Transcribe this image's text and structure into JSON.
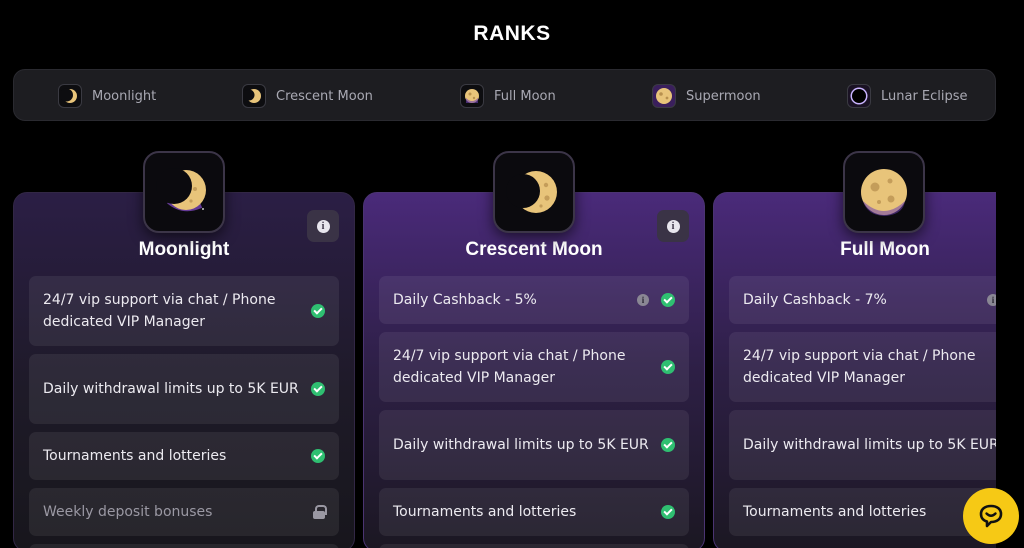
{
  "page": {
    "title": "RANKS"
  },
  "rank_tabs": [
    {
      "label": "Moonlight",
      "icon": "moonlight-icon"
    },
    {
      "label": "Crescent Moon",
      "icon": "crescent-moon-icon"
    },
    {
      "label": "Full Moon",
      "icon": "full-moon-icon"
    },
    {
      "label": "Supermoon",
      "icon": "supermoon-icon"
    },
    {
      "label": "Lunar Eclipse",
      "icon": "lunar-eclipse-icon"
    }
  ],
  "cards": [
    {
      "title": "Moonlight",
      "features": [
        {
          "text": "24/7 vip support via chat / Phone dedicated VIP Manager",
          "status": "check"
        },
        {
          "text": "Daily withdrawal limits up to 5K EUR",
          "status": "check"
        },
        {
          "text": "Tournaments and lotteries",
          "status": "check"
        },
        {
          "text": "Weekly deposit bonuses",
          "status": "locked"
        }
      ]
    },
    {
      "title": "Crescent Moon",
      "features": [
        {
          "text": "Daily Cashback - 5%",
          "status": "check",
          "info": true
        },
        {
          "text": "24/7 vip support via chat / Phone dedicated VIP Manager",
          "status": "check"
        },
        {
          "text": "Daily withdrawal limits up to 5K EUR",
          "status": "check"
        },
        {
          "text": "Tournaments and lotteries",
          "status": "check"
        }
      ]
    },
    {
      "title": "Full Moon",
      "features": [
        {
          "text": "Daily Cashback - 7%",
          "status": "check",
          "info": true
        },
        {
          "text": "24/7 vip support via chat / Phone dedicated VIP Manager",
          "status": "check"
        },
        {
          "text": "Daily withdrawal limits up to 5K EUR",
          "status": "check"
        },
        {
          "text": "Tournaments and lotteries",
          "status": "check"
        }
      ]
    }
  ],
  "icons": {
    "info": "info-icon",
    "check": "check-circle-icon",
    "lock": "lock-icon",
    "chat": "chat-bubble-icon"
  },
  "colors": {
    "accent": "#f6c915",
    "check": "#2fbf71",
    "background": "#000000",
    "tabs_bg": "#1d1d21"
  }
}
